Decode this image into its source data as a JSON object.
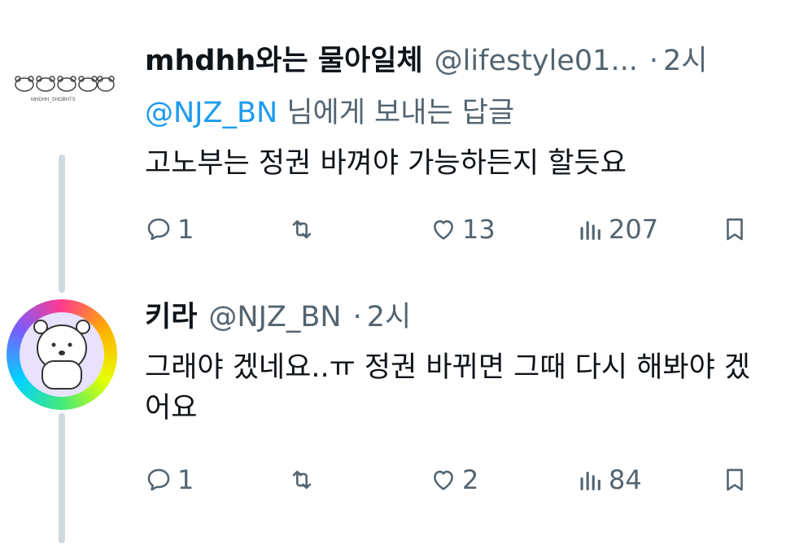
{
  "tweets": [
    {
      "name": "mhdhh와는 물아일체",
      "handle": "@lifestyle01...",
      "time": "2시",
      "reply_to_mention": "@NJZ_BN",
      "reply_to_suffix": " 님에게 보내는 답글",
      "text": "고노부는 정권 바껴야 가능하든지 할듯요",
      "replies": "1",
      "likes": "13",
      "views": "207"
    },
    {
      "name": "키라",
      "handle": "@NJZ_BN",
      "time": "2시",
      "text": "그래야 겠네요..ㅠ 정권 바뀌면 그때 다시 해봐야 겠어요",
      "replies": "1",
      "likes": "2",
      "views": "84"
    }
  ],
  "separator": "·",
  "avatar1_caption": "MHDHH_SHOBHTS",
  "colors": {
    "mention": "#1d9bf0",
    "secondary_text": "#536471",
    "thread_line": "#cfd9de"
  },
  "icons": [
    "reply-icon",
    "retweet-icon",
    "heart-icon",
    "views-icon",
    "bookmark-icon",
    "share-icon"
  ]
}
